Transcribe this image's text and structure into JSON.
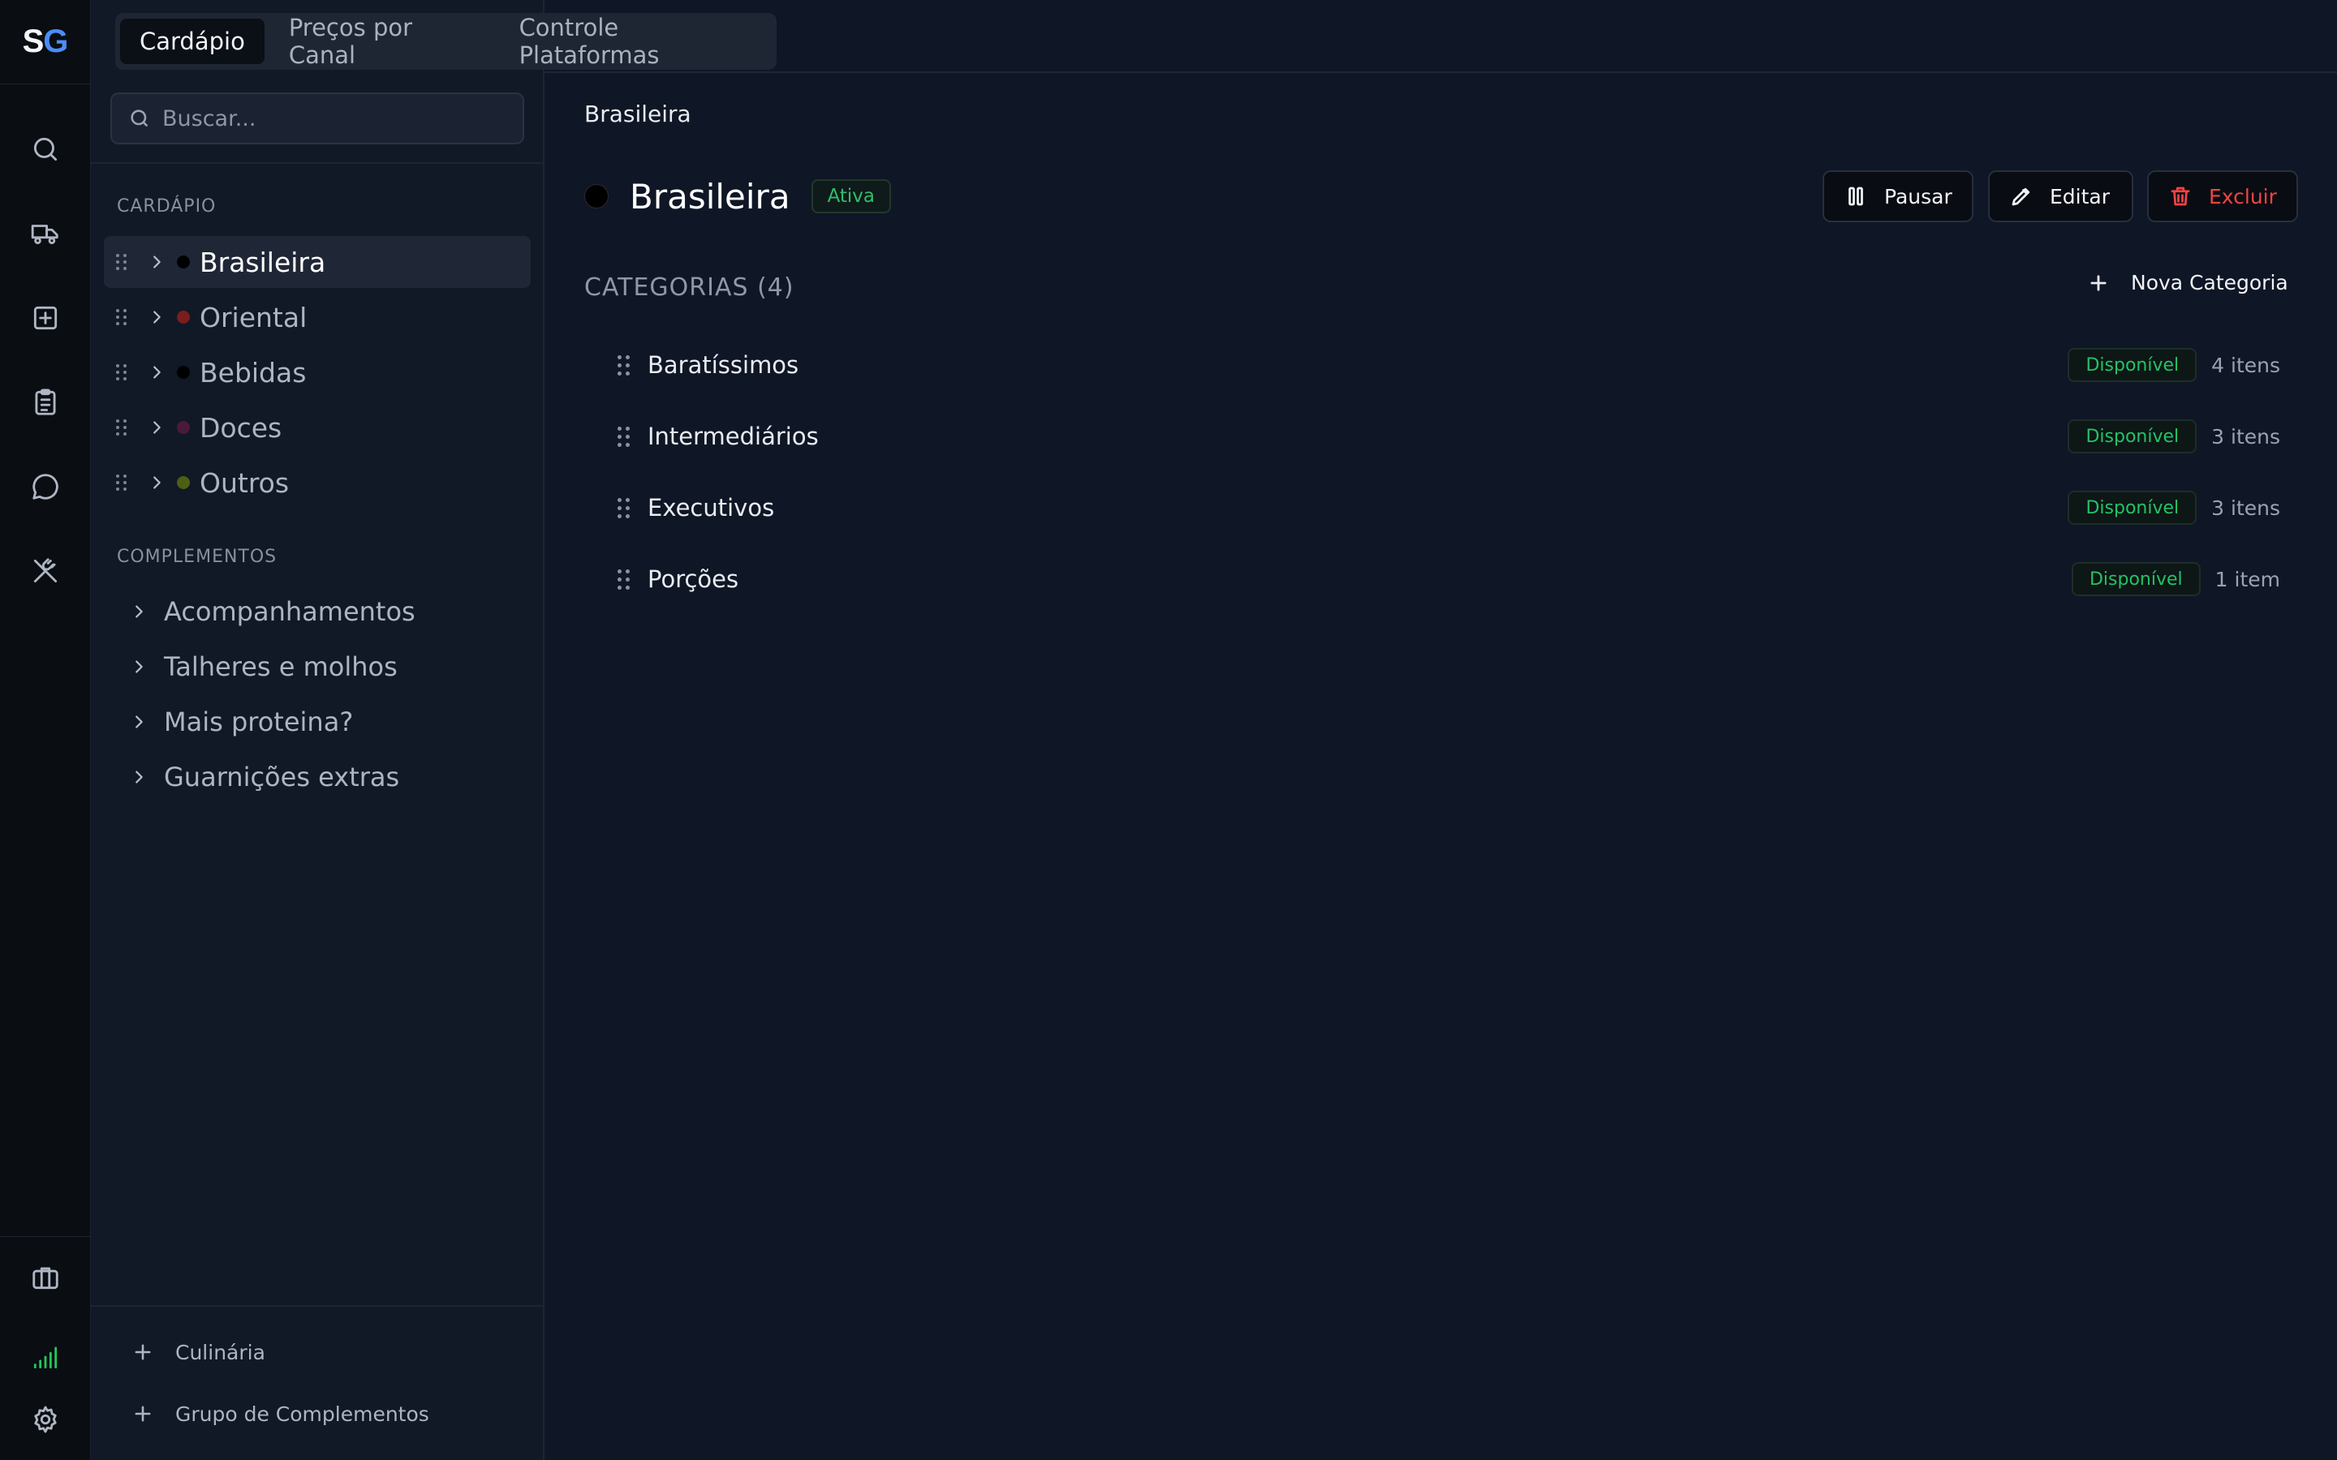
{
  "logo": {
    "part1": "S",
    "part2": "G"
  },
  "rail": {
    "top_icons": [
      "search-icon",
      "truck-icon",
      "plus-square-icon",
      "clipboard-icon",
      "chat-icon",
      "utensils-icon"
    ],
    "bottom_icons": [
      "briefcase-icon",
      "signal-icon",
      "gear-icon"
    ],
    "signal_color": "#22c55e"
  },
  "tabs": [
    {
      "label": "Cardápio",
      "active": true
    },
    {
      "label": "Preços por Canal",
      "active": false
    },
    {
      "label": "Controle Plataformas",
      "active": false
    }
  ],
  "search": {
    "placeholder": "Buscar...",
    "value": ""
  },
  "sidebar": {
    "menu_label": "CARDÁPIO",
    "categories": [
      {
        "name": "Brasileira",
        "color": "#000000",
        "active": true
      },
      {
        "name": "Oriental",
        "color": "#7a1d1d",
        "active": false
      },
      {
        "name": "Bebidas",
        "color": "#000000",
        "active": false
      },
      {
        "name": "Doces",
        "color": "#4a1a3a",
        "active": false
      },
      {
        "name": "Outros",
        "color": "#4d5f12",
        "active": false
      }
    ],
    "complements_label": "COMPLEMENTOS",
    "complements": [
      "Acompanhamentos",
      "Talheres e molhos",
      "Mais proteina?",
      "Guarnições extras"
    ],
    "add_culinaria": "Culinária",
    "add_group": "Grupo de Complementos"
  },
  "main": {
    "breadcrumb": "Brasileira",
    "title": "Brasileira",
    "status": "Ativa",
    "title_color": "#000000",
    "buttons": {
      "pause": "Pausar",
      "edit": "Editar",
      "delete": "Excluir"
    },
    "delete_color": "#ef4444",
    "categories_label": "CATEGORIAS (4)",
    "new_category": "Nova Categoria",
    "subcategories": [
      {
        "name": "Baratíssimos",
        "status": "Disponível",
        "count": "4 itens"
      },
      {
        "name": "Intermediários",
        "status": "Disponível",
        "count": "3 itens"
      },
      {
        "name": "Executivos",
        "status": "Disponível",
        "count": "3 itens"
      },
      {
        "name": "Porções",
        "status": "Disponível",
        "count": "1 item"
      }
    ]
  }
}
